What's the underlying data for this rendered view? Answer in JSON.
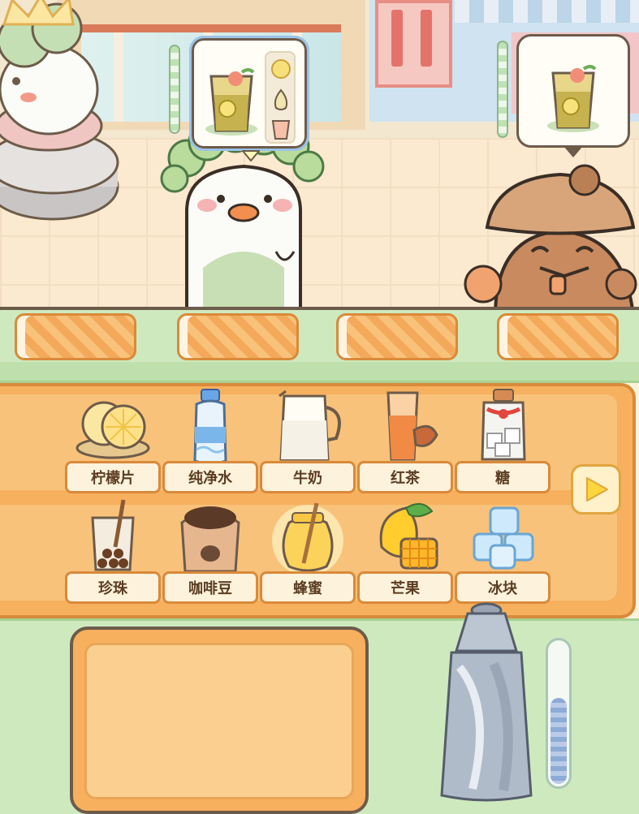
{
  "order": {
    "drink_icon": "lemon-iced-tea-icon",
    "recipe_icons": [
      "lemon-slice-icon",
      "pear-honey-icon",
      "ice-cup-icon"
    ]
  },
  "side_order": {
    "drink_icon": "lemon-iced-tea-icon"
  },
  "ingredients": [
    {
      "label": "柠檬片",
      "icon": "lemon-slices-icon"
    },
    {
      "label": "纯净水",
      "icon": "water-bottle-icon"
    },
    {
      "label": "牛奶",
      "icon": "milk-jug-icon"
    },
    {
      "label": "红茶",
      "icon": "black-tea-icon"
    },
    {
      "label": "糖",
      "icon": "sugar-jar-icon"
    },
    {
      "label": "珍珠",
      "icon": "boba-cup-icon"
    },
    {
      "label": "咖啡豆",
      "icon": "coffee-beans-sack-icon"
    },
    {
      "label": "蜂蜜",
      "icon": "honey-jar-icon"
    },
    {
      "label": "芒果",
      "icon": "mango-icon"
    },
    {
      "label": "冰块",
      "icon": "ice-cubes-icon"
    }
  ],
  "shaker_fill_level": 0.62,
  "colors": {
    "panel": "#f6b05e",
    "label_bg": "#fdf2dc",
    "counter": "#cfe9bf",
    "outline": "#6d5b4a"
  }
}
